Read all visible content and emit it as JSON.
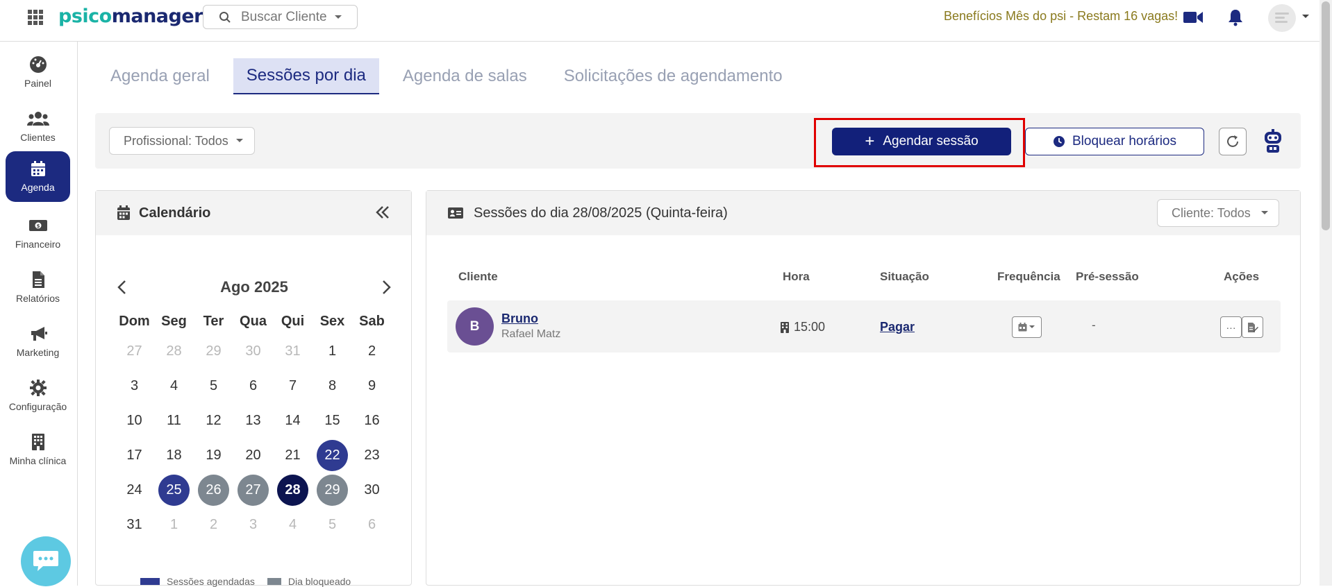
{
  "topbar": {
    "logo_psico": "psico",
    "logo_manager": "manager",
    "search_placeholder": "Buscar Cliente",
    "promo": "Benefícios Mês do psi - Restam 16 vagas!"
  },
  "sidebar": {
    "items": [
      {
        "label": "Painel",
        "icon": "gauge-icon"
      },
      {
        "label": "Clientes",
        "icon": "users-icon"
      },
      {
        "label": "Agenda",
        "icon": "calendar-icon",
        "active": true
      },
      {
        "label": "Financeiro",
        "icon": "money-icon"
      },
      {
        "label": "Relatórios",
        "icon": "file-icon"
      },
      {
        "label": "Marketing",
        "icon": "megaphone-icon"
      },
      {
        "label": "Configuração",
        "icon": "gear-icon"
      },
      {
        "label": "Minha clínica",
        "icon": "building-icon"
      }
    ]
  },
  "tabs": [
    "Agenda geral",
    "Sessões por dia",
    "Agenda de salas",
    "Solicitações de agendamento"
  ],
  "active_tab": "Sessões por dia",
  "toolbar": {
    "professional_filter": "Profissional: Todos",
    "schedule_button": "Agendar sessão",
    "block_button": "Bloquear horários"
  },
  "calendar": {
    "title": "Calendário",
    "month": "Ago 2025",
    "weekdays": [
      "Dom",
      "Seg",
      "Ter",
      "Qua",
      "Qui",
      "Sex",
      "Sab"
    ],
    "weeks": [
      [
        "27",
        "28",
        "29",
        "30",
        "31",
        "1",
        "2"
      ],
      [
        "3",
        "4",
        "5",
        "6",
        "7",
        "8",
        "9"
      ],
      [
        "10",
        "11",
        "12",
        "13",
        "14",
        "15",
        "16"
      ],
      [
        "17",
        "18",
        "19",
        "20",
        "21",
        "22",
        "23"
      ],
      [
        "24",
        "25",
        "26",
        "27",
        "28",
        "29",
        "30"
      ],
      [
        "31",
        "1",
        "2",
        "3",
        "4",
        "5",
        "6"
      ]
    ],
    "legend_scheduled": "Sessões agendadas",
    "legend_blocked": "Dia bloqueado",
    "colors": {
      "scheduled": "#2f3b91",
      "blocked": "#7d8790",
      "selected": "#0c1450"
    }
  },
  "sessions": {
    "title": "Sessões do dia 28/08/2025 (Quinta-feira)",
    "client_filter": "Cliente: Todos",
    "columns": [
      "Cliente",
      "Hora",
      "Situação",
      "Frequência",
      "Pré-sessão",
      "Ações"
    ],
    "rows": [
      {
        "initial": "B",
        "client": "Bruno",
        "professional": "Rafael Matz",
        "time": "15:00",
        "status": "Pagar",
        "pre_session": "-",
        "actions_more": "···"
      }
    ]
  }
}
